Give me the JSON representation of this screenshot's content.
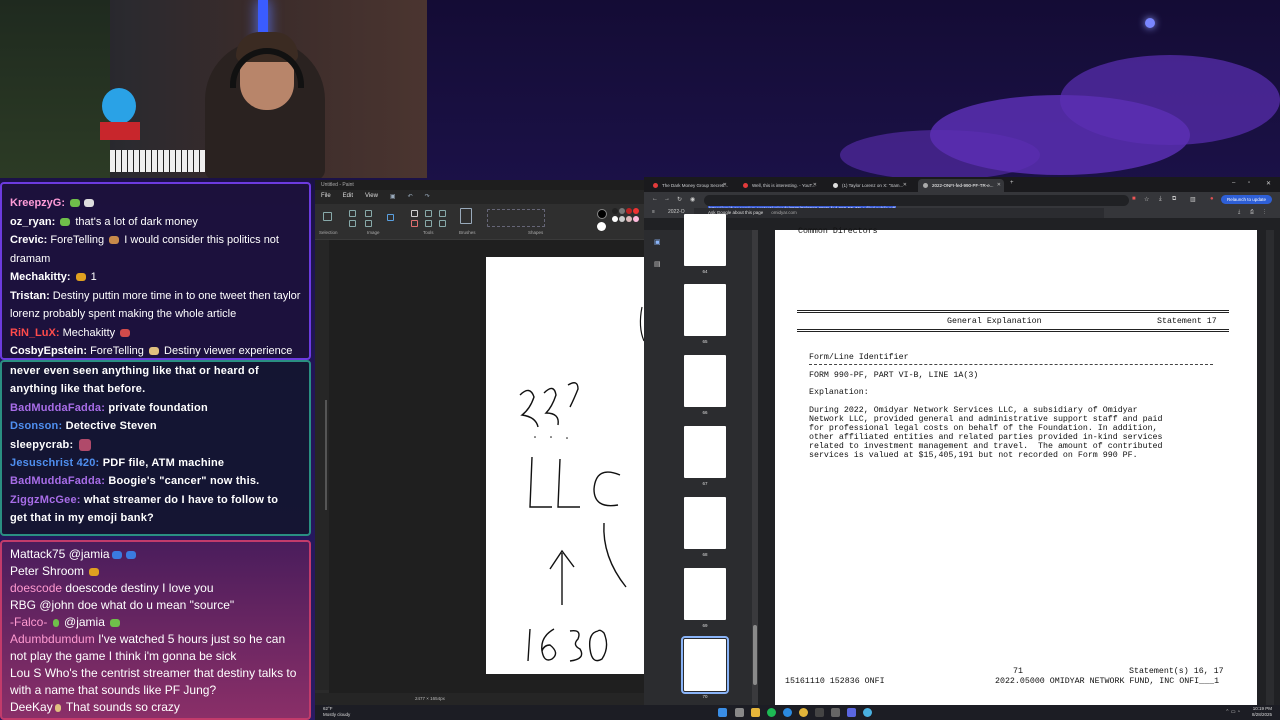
{
  "chat_top": {
    "messages": [
      {
        "user": "KreepzyG:",
        "user_color": "#ff9cd8",
        "text": ""
      },
      {
        "user": "oz_ryan:",
        "user_color": "#ffffff",
        "text": "that's a lot of dark money"
      },
      {
        "user": "Crevic:",
        "user_color": "#ffffff",
        "text": "ForeTelling"
      },
      {
        "user": "",
        "user_color": "#ffffff",
        "text": "I would consider this politics not dramam"
      },
      {
        "user": "Mechakitty:",
        "user_color": "#ffffff",
        "text": "1"
      },
      {
        "user": "Tristan:",
        "user_color": "#ffffff",
        "text": "Destiny puttin more time in to one tweet then taylor lorenz probably spent making the whole article"
      },
      {
        "user": "RiN_LuX:",
        "user_color": "#ff4b4b",
        "text": "Mechakitty"
      },
      {
        "user": "CosbyEpstein:",
        "user_color": "#ffffff",
        "text": "ForeTelling"
      },
      {
        "user": "",
        "user_color": "#ffffff",
        "text": "Destiny viewer experience"
      }
    ]
  },
  "chat_mid": {
    "lines": [
      {
        "user": "",
        "text": "never even seen anything like that or heard of"
      },
      {
        "user": "",
        "text": "anything like that before."
      },
      {
        "user": "BadMuddaFadda:",
        "user_color": "#a86de8",
        "text": "private foundation"
      },
      {
        "user": "Dsonson:",
        "user_color": "#4f8ff0",
        "text": "Detective Steven"
      },
      {
        "user": "sleepycrab:",
        "user_color": "#ffffff",
        "text": ""
      },
      {
        "user": "Jesuschrist 420:",
        "user_color": "#4f8ff0",
        "text": "PDF file, ATM machine"
      },
      {
        "user": "BadMuddaFadda:",
        "user_color": "#a86de8",
        "text": "Boogie's \"cancer\" now this."
      },
      {
        "user": "ZiggzMcGee:",
        "user_color": "#a86de8",
        "text": "what streamer do I have to follow to"
      },
      {
        "user": "",
        "text": "get that in my emoji bank?"
      }
    ]
  },
  "chat_bottom": {
    "messages": [
      {
        "user": "Mattack75",
        "user_color": "#ffffff",
        "text": "@jamia"
      },
      {
        "user": "Peter Shroom",
        "user_color": "#ffffff",
        "text": ""
      },
      {
        "user": "doescode",
        "user_color": "#ff9ad1",
        "text": "doescode destiny I love you"
      },
      {
        "user": "RBG",
        "user_color": "#ffffff",
        "text": "@john doe what do u mean \"source\""
      },
      {
        "user": "-Falco-",
        "user_color": "#ff9ad1",
        "text": "@jamia"
      },
      {
        "user": "Adumbdumdum",
        "user_color": "#ff9ad1",
        "text": "I've watched 5 hours just so he can not play the game I think i'm gonna be sick"
      },
      {
        "user": "Lou S",
        "user_color": "#ffffff",
        "text": "Who's the centrist streamer that destiny talks to with a name that sounds like PF Jung?"
      },
      {
        "user": "DeeKay",
        "user_color": "#ffffff",
        "text": "That sounds so crazy"
      }
    ]
  },
  "paint": {
    "title": "Untitled - Paint",
    "menu": [
      "File",
      "Edit",
      "View"
    ],
    "groups": [
      "Selection",
      "Image",
      "Tools",
      "Brushes",
      "Shapes"
    ],
    "status_size": "2477 × 1654px",
    "handwriting": [
      "3??",
      "LLC",
      "↑",
      "1630"
    ]
  },
  "browser": {
    "tabs": [
      {
        "label": "The Dark Money Group Secretl...",
        "active": false
      },
      {
        "label": "Well, this is interesting. - YouT...",
        "active": false
      },
      {
        "label": "(1) Taylor Lorenz on X: \"Sam...",
        "active": false
      },
      {
        "label": "2022-ONFI-fed-990-PF-TR-e...",
        "active": true
      }
    ],
    "url": "https://omidyar.com/wp-content/uploads/2025/03/2022-ONFI-fed-990-PF-TR-e-filed-public.pdf",
    "update_label": "Relaunch to update",
    "suggest_text": "Ask Google about this page",
    "suggest_site": "omidyar.com",
    "pdf_name": "2022-O",
    "thumbnails": [
      "64",
      "65",
      "66",
      "67",
      "68",
      "69",
      "70"
    ]
  },
  "pdf": {
    "top_cut": "Common Directors",
    "section_title": "General Explanation",
    "statement": "Statement 17",
    "form_line_label": "Form/Line Identifier",
    "form_line_value": "FORM 990-PF, PART VI-B, LINE 1A(3)",
    "explanation_label": "Explanation:",
    "body": [
      "During 2022, Omidyar Network Services LLC, a subsidiary of Omidyar",
      "Network LLC, provided general and administrative support staff and paid",
      "for professional legal costs on behalf of the Foundation. In addition,",
      "other affiliated entities and related parties provided in-kind services",
      "related to investment management and travel.  The amount of contributed",
      "services is valued at $15,405,191 but not recorded on Form 990 PF."
    ],
    "page_number": "71",
    "footer_right": "Statement(s) 16, 17",
    "footer_left": "15161110 152836 ONFI",
    "footer_mid": "2022.05000 OMIDYAR NETWORK FUND, INC ONFI___1"
  },
  "taskbar": {
    "weather_temp": "62°F",
    "weather_desc": "Mostly cloudy",
    "time": "10:19 PM",
    "date": "8/28/2025"
  }
}
